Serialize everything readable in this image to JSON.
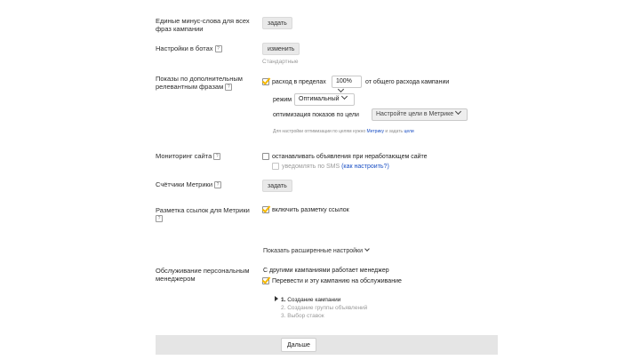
{
  "rows": {
    "minus_words": {
      "label_line1": "Единые минус-слова для всех",
      "label_line2": "фраз кампании",
      "button": "задать"
    },
    "ad_settings": {
      "label": "Настройки в ботах",
      "button": "изменить",
      "sub": "Стандартные"
    },
    "extra_phrases": {
      "label_line1": "Показы по дополнительным",
      "label_line2": "релевантным фразам",
      "checkbox_text": "расход в пределах",
      "percent_value": "100%",
      "suffix": "от общего расхода кампании",
      "mode_label": "режим",
      "mode_value": "Оптимальный",
      "optim_label": "оптимизация показов по цели",
      "optim_value": "Настройте цели в Метрике",
      "note_text": "Для настройки оптимизации по целям нужно",
      "note_link1": "Метрику",
      "note_mid": "и задать",
      "note_link2": "цели"
    },
    "site_monitoring": {
      "label": "Мониторинг сайта",
      "checkbox_text": "останавливать объявления при неработающем сайте",
      "sub_text": "уведомлять по SMS",
      "sub_link": "(как настроить?)"
    },
    "metrika_counters": {
      "label": "Счётчики Метрики",
      "button": "задать"
    },
    "link_markup": {
      "label_line1": "Разметка ссылок для Метрики",
      "checkbox_text": "включить разметку ссылок"
    },
    "show_advanced": "Показать расширенные настройки",
    "personal_manager": {
      "label_line1": "Обслуживание персональным",
      "label_line2": "менеджером",
      "text": "С другими кампаниями работает менеджер",
      "checkbox_text": "Перевести и эту кампанию на обслуживание"
    }
  },
  "steps": [
    {
      "num": "1.",
      "label": "Создание кампании",
      "active": true
    },
    {
      "num": "2.",
      "label": "Создание группы объявлений",
      "active": false
    },
    {
      "num": "3.",
      "label": "Выбор ставок",
      "active": false
    }
  ],
  "footer": {
    "next_button": "Дальше"
  },
  "colors": {
    "check": "#f5b800",
    "link": "#1a4fc4",
    "footer_bg": "#e5e5e5"
  }
}
